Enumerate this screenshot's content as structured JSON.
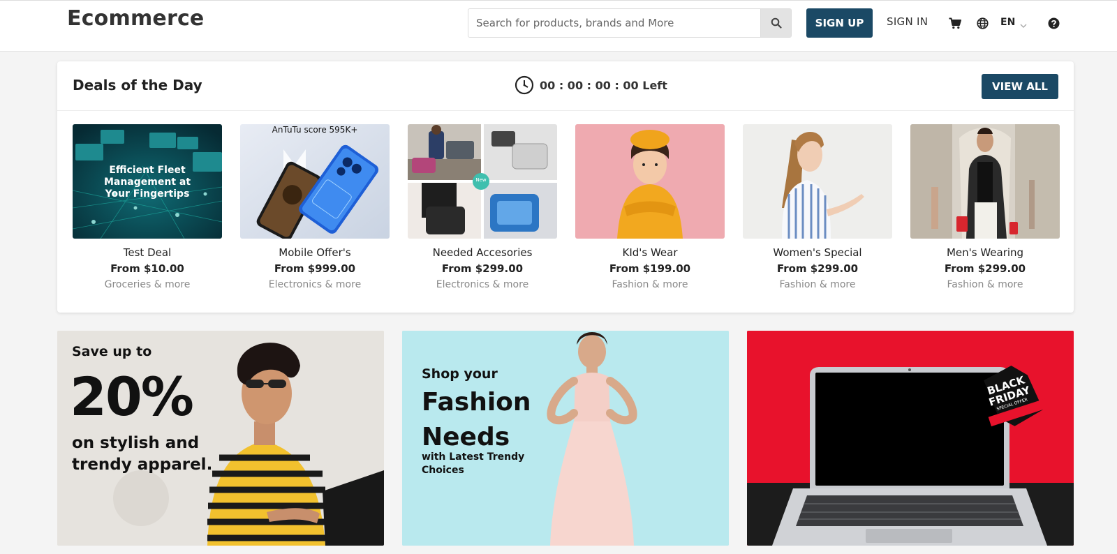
{
  "header": {
    "logo": "Ecommerce",
    "search_placeholder": "Search for products, brands and More",
    "signup_label": "SIGN UP",
    "signin_label": "SIGN IN",
    "language": "EN",
    "icons": [
      "search-icon",
      "cart-icon",
      "globe-icon",
      "chevron-down-icon",
      "help-icon"
    ]
  },
  "deals": {
    "title": "Deals of the Day",
    "timer": "00 : 00 : 00 : 00 Left",
    "view_all_label": "VIEW ALL",
    "items": [
      {
        "name": "Test Deal",
        "price": "From $10.00",
        "category": "Groceries & more",
        "image_text": "Efficient Fleet Management at Your Fingertips"
      },
      {
        "name": "Mobile Offer's",
        "price": "From $999.00",
        "category": "Electronics & more",
        "image_text": "AnTuTu score 595K+"
      },
      {
        "name": "Needed Accesories",
        "price": "From $299.00",
        "category": "Electronics & more",
        "image_text": "New"
      },
      {
        "name": "KId's Wear",
        "price": "From $199.00",
        "category": "Fashion & more"
      },
      {
        "name": "Women's Special",
        "price": "From $299.00",
        "category": "Fashion & more"
      },
      {
        "name": "Men's Wearing",
        "price": "From $299.00",
        "category": "Fashion & more"
      }
    ]
  },
  "banners": [
    {
      "line1": "Save up to",
      "line2": "20%",
      "line3": "on stylish and trendy apparel."
    },
    {
      "line1": "Shop your",
      "line2": "Fashion Needs",
      "line3": "with Latest Trendy Choices"
    },
    {
      "badge_line1": "BLACK",
      "badge_line2": "FRIDAY",
      "badge_line3": "SPECIAL OFFER"
    }
  ],
  "colors": {
    "brand": "#1b4965",
    "background": "#f4f4f4",
    "banner_red": "#e8122c",
    "banner_aqua": "#b9e9ee"
  }
}
